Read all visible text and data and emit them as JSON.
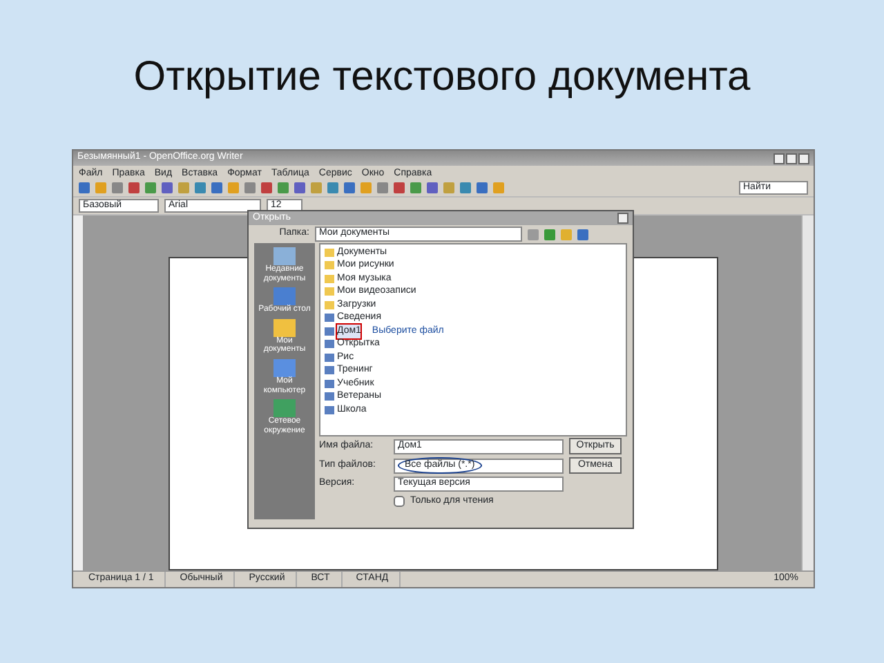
{
  "slide_title": "Открытие текстового документа",
  "window": {
    "title": "Безымянный1 - OpenOffice.org Writer",
    "menu": [
      "Файл",
      "Правка",
      "Вид",
      "Вставка",
      "Формат",
      "Таблица",
      "Сервис",
      "Окно",
      "Справка"
    ],
    "style_box": "Базовый",
    "font_box": "Arial",
    "size_box": "12",
    "find_box": "Найти"
  },
  "dialog": {
    "title": "Открыть",
    "folder_label": "Папка:",
    "folder": "Мои документы",
    "places": [
      {
        "label": "Недавние документы",
        "kind": "recent"
      },
      {
        "label": "Рабочий стол",
        "kind": "desktop"
      },
      {
        "label": "Мои документы",
        "kind": "docs"
      },
      {
        "label": "Мой компьютер",
        "kind": "computer"
      },
      {
        "label": "Сетевое окружение",
        "kind": "network"
      }
    ],
    "files": [
      {
        "name": "Документы",
        "kind": "folder",
        "selected": false
      },
      {
        "name": "Мои рисунки",
        "kind": "folder",
        "selected": false
      },
      {
        "name": "Моя музыка",
        "kind": "folder",
        "selected": false
      },
      {
        "name": "Мои видеозаписи",
        "kind": "folder",
        "selected": false
      },
      {
        "name": "Загрузки",
        "kind": "folder",
        "selected": false
      },
      {
        "name": "Сведения",
        "kind": "doc",
        "selected": false
      },
      {
        "name": "Дом1",
        "kind": "doc",
        "selected": true
      },
      {
        "name": "Открытка",
        "kind": "doc",
        "selected": false
      },
      {
        "name": "Рис",
        "kind": "doc",
        "selected": false
      },
      {
        "name": "Тренинг",
        "kind": "doc",
        "selected": false
      },
      {
        "name": "Учебник",
        "kind": "doc",
        "selected": false
      },
      {
        "name": "Ветераны",
        "kind": "doc",
        "selected": false
      },
      {
        "name": "Школа",
        "kind": "doc",
        "selected": false
      }
    ],
    "annotation": "Выберите файл",
    "filename_label": "Имя файла:",
    "filename": "Дом1",
    "filetype_label": "Тип файлов:",
    "filetype": "Все файлы (*.*)",
    "version_label": "Версия:",
    "version": "Текущая версия",
    "open_button": "Открыть",
    "cancel_button": "Отмена",
    "readonly": {
      "label": "Только для чтения",
      "checked": false
    }
  },
  "status_bar": [
    "Страница 1 / 1",
    "Обычный",
    "Русский",
    "ВСТ",
    "СТАНД",
    "100%"
  ]
}
